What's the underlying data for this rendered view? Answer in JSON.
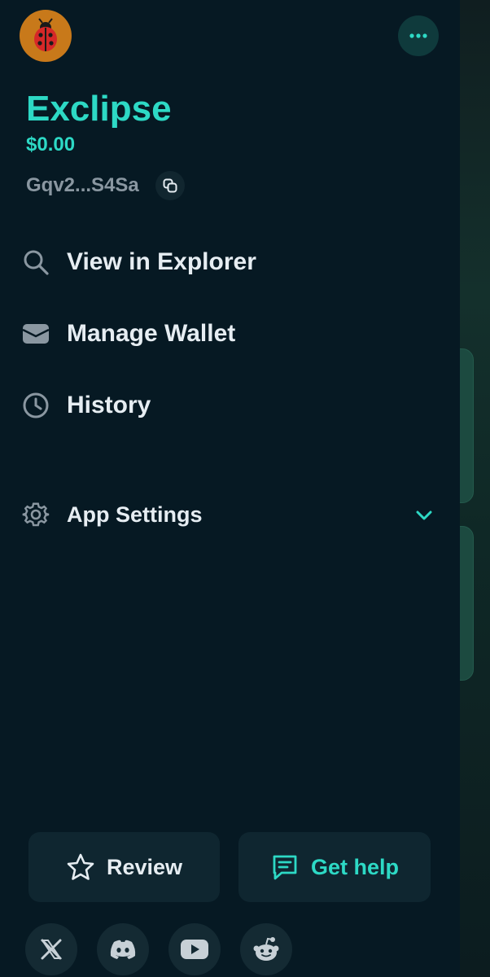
{
  "wallet": {
    "name": "Exclipse",
    "balance": "$0.00",
    "address": "Gqv2...S4Sa"
  },
  "menu": {
    "explorer": "View in Explorer",
    "manage": "Manage Wallet",
    "history": "History",
    "settings": "App Settings"
  },
  "actions": {
    "review": "Review",
    "help": "Get help"
  },
  "social": [
    "x-icon",
    "discord-icon",
    "youtube-icon",
    "reddit-icon"
  ],
  "colors": {
    "accent": "#2dd9c5",
    "drawer_bg": "#061923",
    "text": "#e6edf2",
    "muted": "#8a97a1"
  }
}
